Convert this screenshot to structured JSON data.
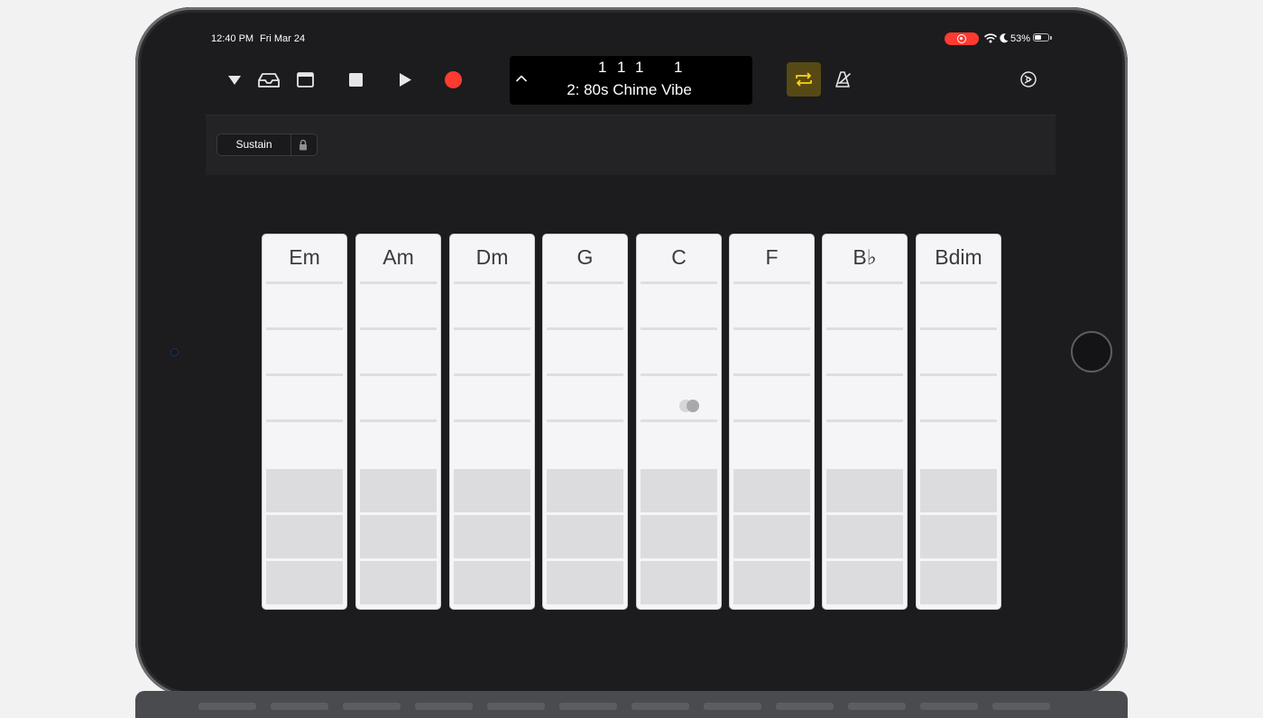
{
  "status_bar": {
    "time": "12:40 PM",
    "date": "Fri Mar 24",
    "battery_percent": "53%",
    "battery_level": 0.53,
    "record_indicator_color": "#ff3b30",
    "icons": [
      "screen-recording-icon",
      "wifi-icon",
      "moon-icon",
      "battery-icon"
    ]
  },
  "toolbar": {
    "left_icons": [
      "track-menu-icon",
      "browser-icon",
      "tracks-view-icon",
      "stop-icon",
      "play-icon",
      "record-icon"
    ],
    "record_color": "#ff3b30",
    "lcd": {
      "position": [
        "1",
        "1",
        "1",
        "1"
      ],
      "song_name": "2: 80s Chime Vibe"
    },
    "right_icons": [
      "cycle-icon",
      "metronome-icon",
      "settings-icon"
    ],
    "cycle_active": true,
    "cycle_color": "#ffcc00"
  },
  "controls": {
    "sustain_label": "Sustain",
    "sustain_locked": true
  },
  "chord_strips": {
    "chords": [
      "Em",
      "Am",
      "Dm",
      "G",
      "C",
      "F",
      "B♭",
      "Bdim"
    ],
    "chord_zones": 5,
    "bass_zones": 3,
    "touch_indicator_strip": "C"
  },
  "colors": {
    "screen_background": "#1c1c1e",
    "strip_background": "#f5f5f7",
    "bass_zone": "#dcdcdf",
    "accent_yellow": "#ffcc00"
  }
}
